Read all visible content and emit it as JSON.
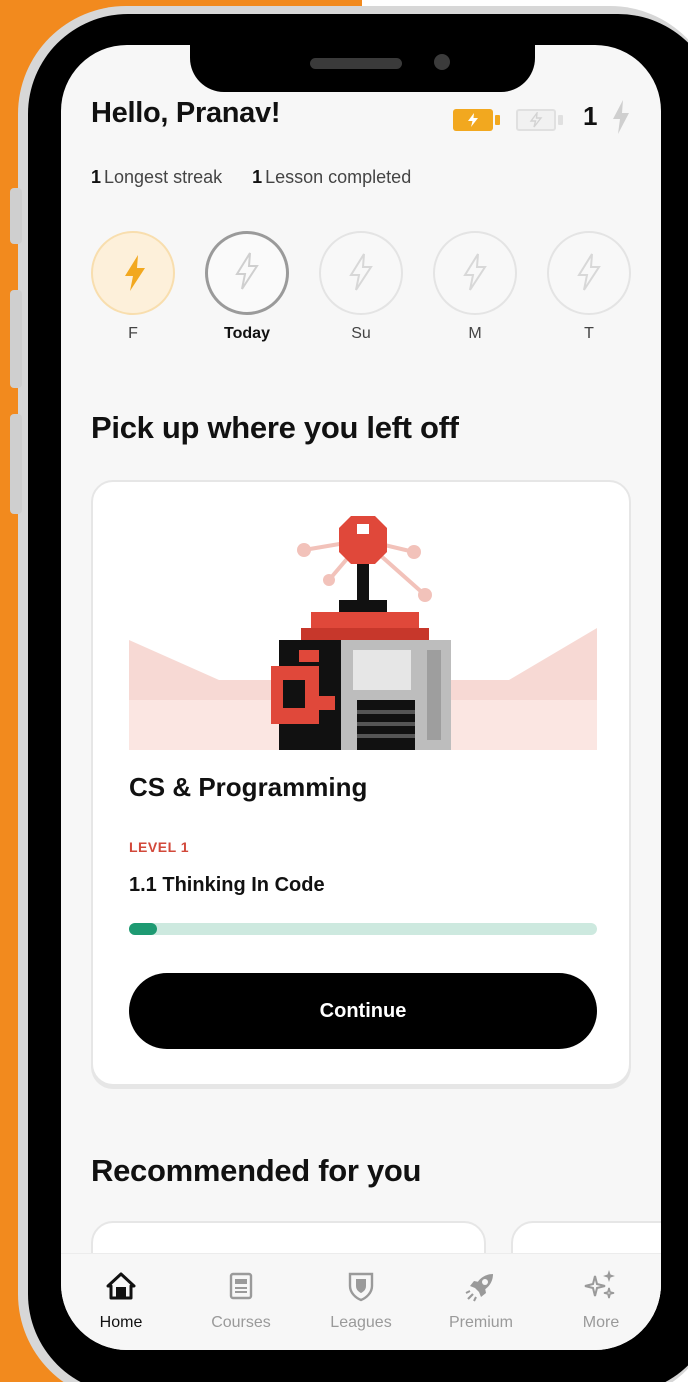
{
  "header": {
    "greeting": "Hello, Pranav!",
    "streak_count": "1"
  },
  "stats": {
    "longest_streak_value": "1",
    "longest_streak_label": "Longest streak",
    "lessons_completed_value": "1",
    "lessons_completed_label": "Lesson completed"
  },
  "week": {
    "days": [
      {
        "label": "F",
        "state": "done"
      },
      {
        "label": "Today",
        "state": "today"
      },
      {
        "label": "Su",
        "state": "future"
      },
      {
        "label": "M",
        "state": "future"
      },
      {
        "label": "T",
        "state": "future"
      }
    ]
  },
  "continue_section": {
    "title": "Pick up where you left off",
    "course_title": "CS & Programming",
    "level": "LEVEL 1",
    "lesson": "1.1 Thinking In Code",
    "progress_fraction": 0.06,
    "button_label": "Continue"
  },
  "recommended": {
    "title": "Recommended for you"
  },
  "nav": {
    "items": [
      {
        "label": "Home",
        "icon": "home-icon",
        "active": true
      },
      {
        "label": "Courses",
        "icon": "courses-icon",
        "active": false
      },
      {
        "label": "Leagues",
        "icon": "leagues-shield-icon",
        "active": false
      },
      {
        "label": "Premium",
        "icon": "premium-rocket-icon",
        "active": false
      },
      {
        "label": "More",
        "icon": "sparkles-icon",
        "active": false
      }
    ]
  },
  "colors": {
    "background_orange": "#F28A1E",
    "streak_orange": "#F2A81F",
    "level_red": "#D2483A",
    "progress_green": "#1E9A72",
    "progress_track": "#CDE9DF"
  }
}
